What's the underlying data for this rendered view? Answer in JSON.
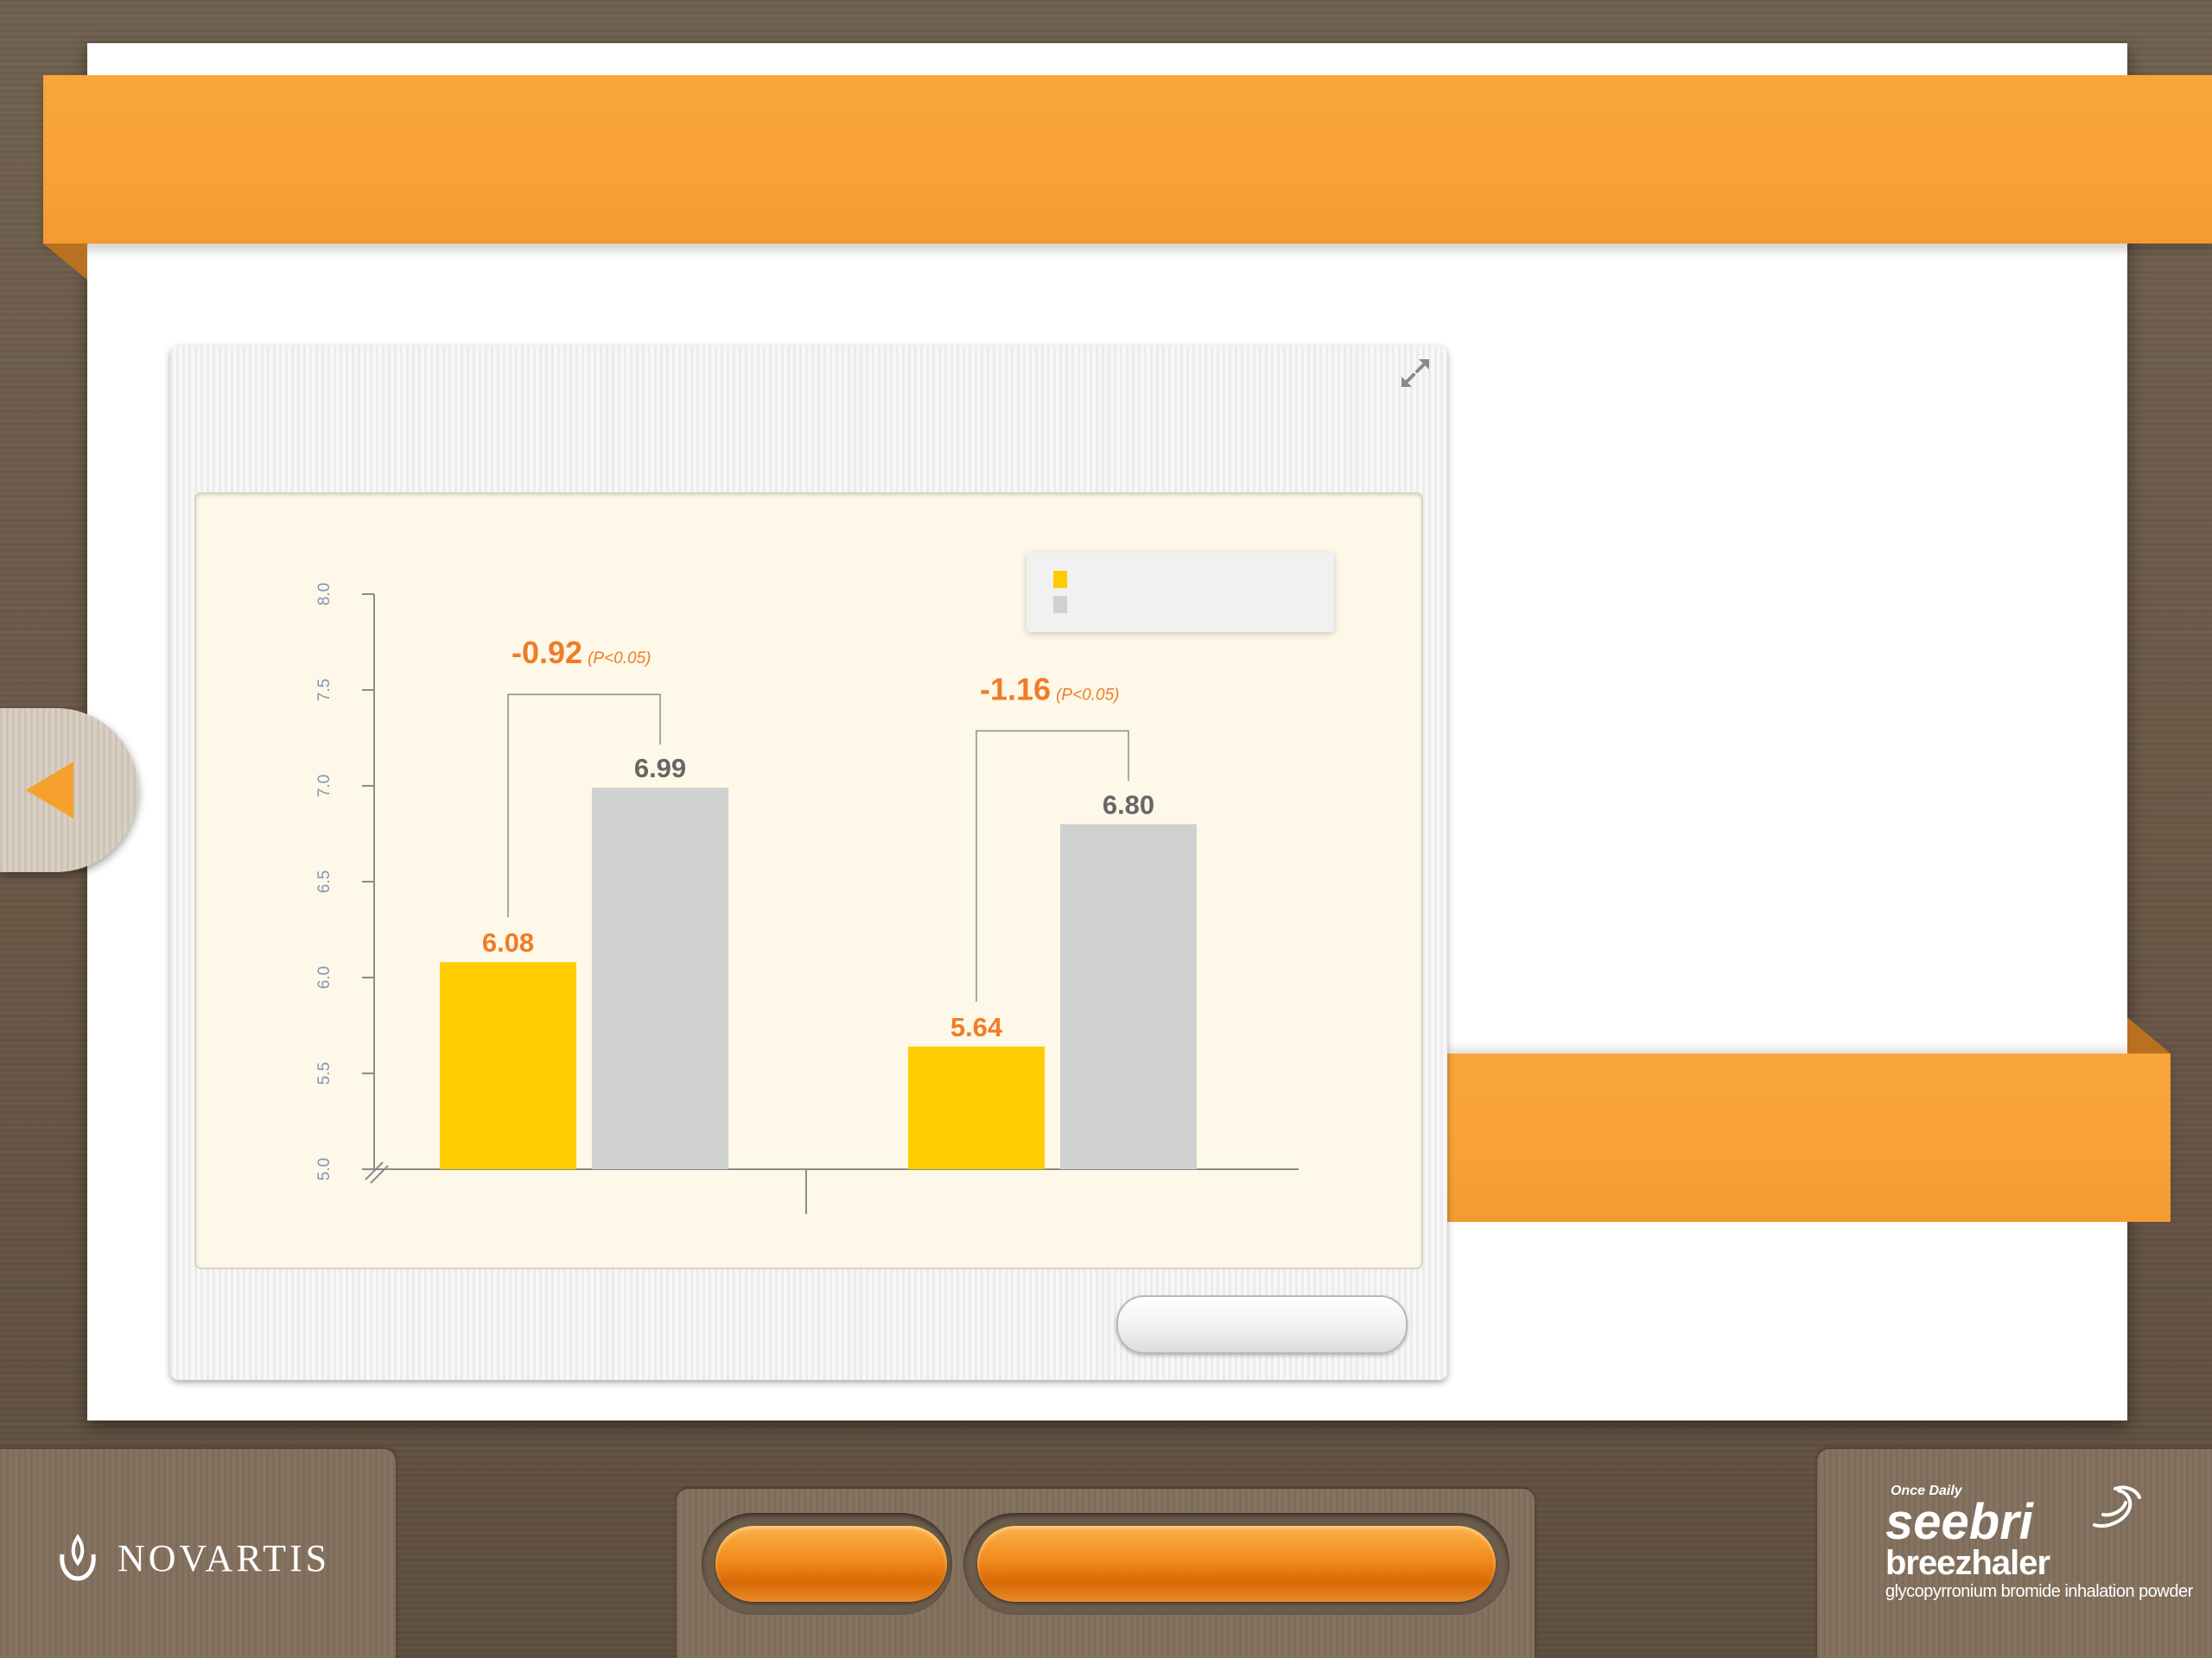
{
  "brand": {
    "company": "NOVARTIS",
    "product_tagline": "Once Daily",
    "product_name_1": "seebri",
    "product_name_2": "breezhaler",
    "product_generic": "glycopyrronium bromide inhalation powder",
    "accent_color": "#f7a137",
    "nav_button_color": "#f28a1b"
  },
  "icons": {
    "back": "back-arrow-icon",
    "expand": "expand-icon",
    "company_logo": "novartis-flame-icon",
    "product_logo": "swirl-icon"
  },
  "chart_data": {
    "type": "bar",
    "title": "",
    "xlabel": "",
    "ylabel": "",
    "ylim": [
      5.0,
      8.0
    ],
    "yticks": [
      "5.0",
      "5.5",
      "6.0",
      "6.5",
      "7.0",
      "7.5",
      "8.0"
    ],
    "grid": false,
    "legend_position": "top-right",
    "categories": [
      "",
      ""
    ],
    "series": [
      {
        "name": "",
        "color": "#ffcc00",
        "label_color": "#f07c28",
        "values": [
          6.08,
          5.64
        ],
        "labels": [
          "6.08",
          "5.64"
        ]
      },
      {
        "name": "",
        "color": "#cfd0d0",
        "label_color": "#666666",
        "values": [
          6.99,
          6.8
        ],
        "labels": [
          "6.99",
          "6.80"
        ]
      }
    ],
    "annotations": [
      {
        "difference": "-0.92",
        "p_value": "(P<0.05)"
      },
      {
        "difference": "-1.16",
        "p_value": "(P<0.05)"
      }
    ]
  }
}
